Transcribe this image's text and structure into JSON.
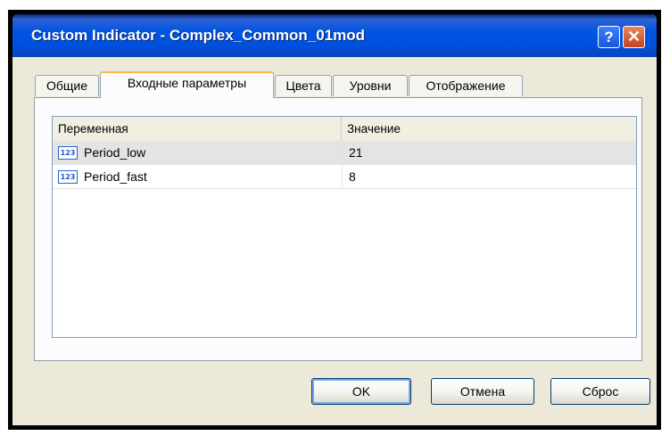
{
  "window": {
    "title": "Custom Indicator - Complex_Common_01mod",
    "help_label": "?",
    "close_label": "✕"
  },
  "tabs": [
    {
      "label": "Общие"
    },
    {
      "label": "Входные параметры"
    },
    {
      "label": "Цвета"
    },
    {
      "label": "Уровни"
    },
    {
      "label": "Отображение"
    }
  ],
  "active_tab": "Входные параметры",
  "table": {
    "columns": [
      "Переменная",
      "Значение"
    ],
    "rows": [
      {
        "icon": "integer-type-icon",
        "icon_text": "123",
        "name": "Period_low",
        "value": "21",
        "selected": true
      },
      {
        "icon": "integer-type-icon",
        "icon_text": "123",
        "name": "Period_fast",
        "value": "8",
        "selected": false
      }
    ]
  },
  "buttons": {
    "ok": "OK",
    "cancel": "Отмена",
    "reset": "Сброс"
  },
  "colors": {
    "titlebar": "#0054e3",
    "dialog_bg": "#ece9d8",
    "active_tab_accent": "#f8b64b"
  }
}
